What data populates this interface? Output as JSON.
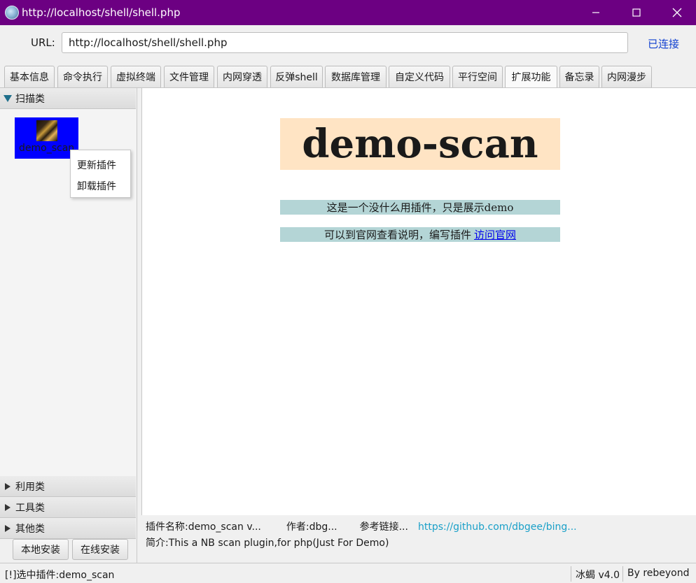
{
  "window": {
    "title": "http://localhost/shell/shell.php"
  },
  "url_bar": {
    "label": "URL:",
    "value": "http://localhost/shell/shell.php",
    "status": "已连接"
  },
  "tabs": [
    {
      "label": "基本信息",
      "active": false
    },
    {
      "label": "命令执行",
      "active": false
    },
    {
      "label": "虚拟终端",
      "active": false
    },
    {
      "label": "文件管理",
      "active": false
    },
    {
      "label": "内网穿透",
      "active": false
    },
    {
      "label": "反弹shell",
      "active": false
    },
    {
      "label": "数据库管理",
      "active": false
    },
    {
      "label": "自定义代码",
      "active": false
    },
    {
      "label": "平行空间",
      "active": false
    },
    {
      "label": "扩展功能",
      "active": true
    },
    {
      "label": "备忘录",
      "active": false
    },
    {
      "label": "内网漫步",
      "active": false
    }
  ],
  "sidebar": {
    "categories": [
      {
        "label": "扫描类",
        "expanded": true
      },
      {
        "label": "利用类",
        "expanded": false
      },
      {
        "label": "工具类",
        "expanded": false
      },
      {
        "label": "其他类",
        "expanded": false
      }
    ],
    "plugin": {
      "name": "demo_scan"
    },
    "context_menu": [
      "更新插件",
      "卸载插件"
    ],
    "buttons": {
      "local_install": "本地安装",
      "online_install": "在线安装"
    }
  },
  "content": {
    "title": "demo-scan",
    "line1": "这是一个没什么用插件，只是展示demo",
    "line2": "可以到官网查看说明，编写插件",
    "link": "访问官网"
  },
  "info": {
    "name_label": "插件名称:",
    "name_value": "demo_scan v...",
    "author_label": "作者:",
    "author_value": "dbg...",
    "ref_label": "参考链接...",
    "ref_value": "https://github.com/dbgee/bing...",
    "desc_label": "简介:",
    "desc_value": "This a NB scan plugin,for php(Just For Demo)"
  },
  "statusbar": {
    "selected": "[!]选中插件:demo_scan",
    "version": "冰蝎 v4.0",
    "author": "By rebeyond"
  },
  "colors": {
    "titlebar": "#6c0082",
    "tile": "#0000ff",
    "title_bg": "#ffe4c4",
    "line_bg": "#b4d5d6",
    "link": "#1aa0c8",
    "status": "#1040d0"
  }
}
